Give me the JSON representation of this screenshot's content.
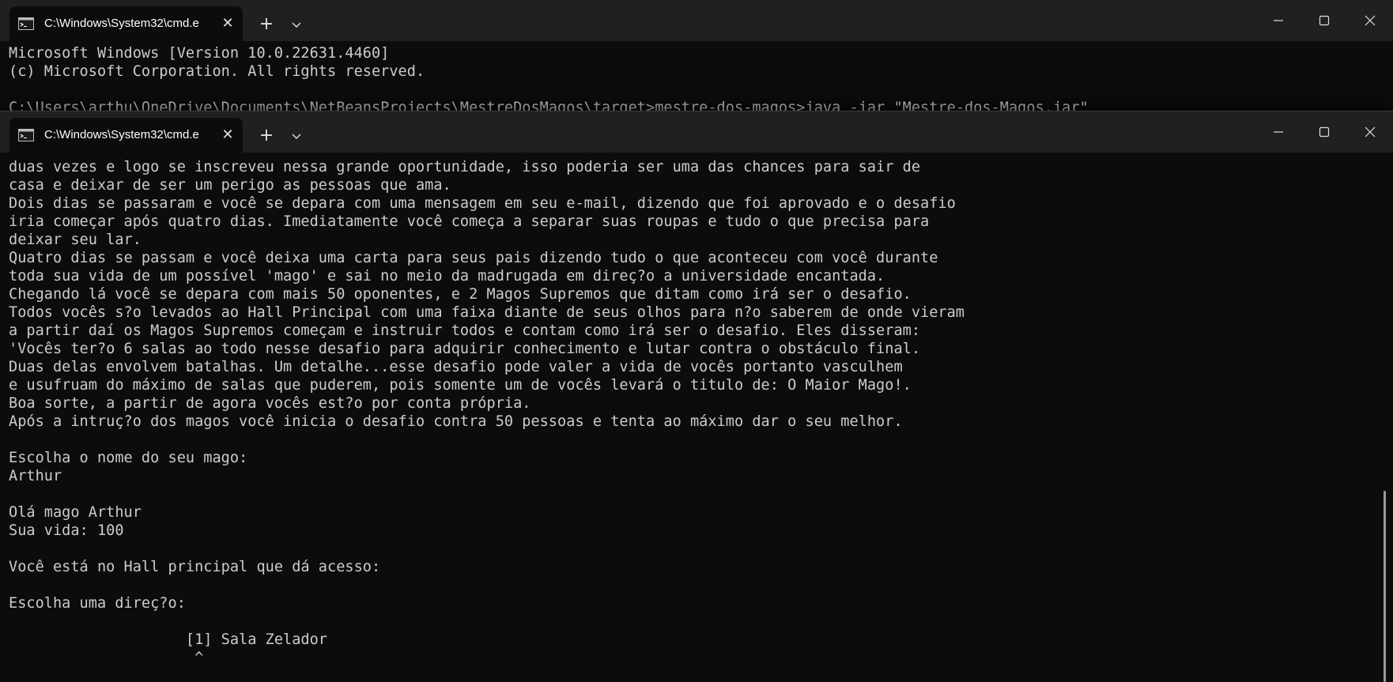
{
  "back_window": {
    "tab_title": "C:\\Windows\\System32\\cmd.e",
    "lines": [
      "Microsoft Windows [Version 10.0.22631.4460]",
      "(c) Microsoft Corporation. All rights reserved.",
      "",
      "C:\\Users\\arthu\\OneDrive\\Documents\\NetBeansProjects\\MestreDosMagos\\target>mestre-dos-magos>java -jar \"Mestre-dos-Magos.jar\""
    ]
  },
  "front_window": {
    "tab_title": "C:\\Windows\\System32\\cmd.e",
    "lines": [
      "duas vezes e logo se inscreveu nessa grande oportunidade, isso poderia ser uma das chances para sair de",
      "casa e deixar de ser um perigo as pessoas que ama.",
      "Dois dias se passaram e você se depara com uma mensagem em seu e-mail, dizendo que foi aprovado e o desafio",
      "iria começar após quatro dias. Imediatamente você começa a separar suas roupas e tudo o que precisa para",
      "deixar seu lar.",
      "Quatro dias se passam e você deixa uma carta para seus pais dizendo tudo o que aconteceu com você durante",
      "toda sua vida de um possível 'mago' e sai no meio da madrugada em direç?o a universidade encantada.",
      "Chegando lá você se depara com mais 50 oponentes, e 2 Magos Supremos que ditam como irá ser o desafio.",
      "Todos vocês s?o levados ao Hall Principal com uma faixa diante de seus olhos para n?o saberem de onde vieram",
      "a partir daí os Magos Supremos começam e instruir todos e contam como irá ser o desafio. Eles disseram:",
      "'Vocês ter?o 6 salas ao todo nesse desafio para adquirir conhecimento e lutar contra o obstáculo final.",
      "Duas delas envolvem batalhas. Um detalhe...esse desafio pode valer a vida de vocês portanto vasculhem",
      "e usufruam do máximo de salas que puderem, pois somente um de vocês levará o titulo de: O Maior Mago!.",
      "Boa sorte, a partir de agora vocês est?o por conta própria.",
      "Após a intruç?o dos magos você inicia o desafio contra 50 pessoas e tenta ao máximo dar o seu melhor.",
      "",
      "Escolha o nome do seu mago:",
      "Arthur",
      "",
      "Olá mago Arthur",
      "Sua vida: 100",
      "",
      "Você está no Hall principal que dá acesso:",
      "",
      "Escolha uma direç?o:",
      "",
      "                    [1] Sala Zelador",
      "                     ^"
    ]
  },
  "colors": {
    "titlebar": "#202020",
    "background": "#0c0c0c",
    "text": "#cccccc"
  },
  "icons": {
    "tab": "cmd-prompt-icon",
    "close_tab": "close-icon",
    "new_tab": "plus-icon",
    "dropdown": "chevron-down-icon",
    "minimize": "minimize-icon",
    "maximize": "maximize-icon",
    "close_window": "close-icon"
  }
}
